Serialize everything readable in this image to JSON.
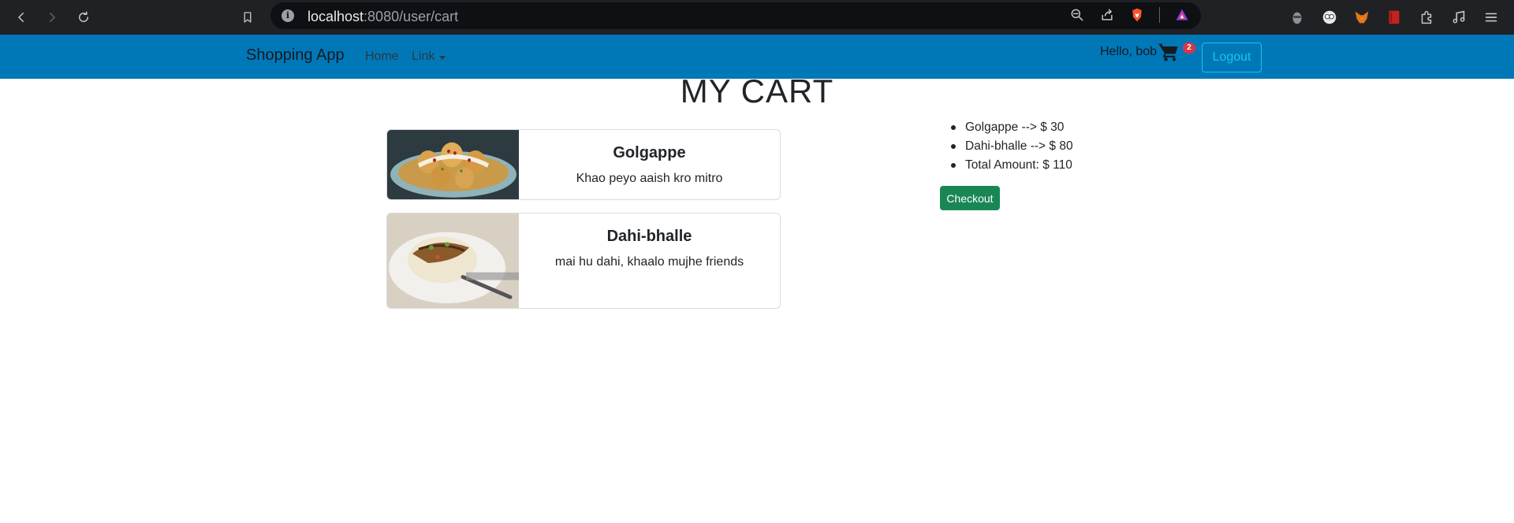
{
  "browser": {
    "url_host": "localhost",
    "url_path": ":8080/user/cart"
  },
  "navbar": {
    "brand": "Shopping App",
    "home_label": "Home",
    "link_label": "Link",
    "greeting": "Hello, bob",
    "cart_count": "2",
    "logout_label": "Logout"
  },
  "page": {
    "title": "MY CART"
  },
  "cart_items": [
    {
      "name": "Golgappe",
      "description": "Khao peyo aaish kro mitro"
    },
    {
      "name": "Dahi-bhalle",
      "description": "mai hu dahi, khaalo mujhe friends"
    }
  ],
  "summary": {
    "lines": [
      "Golgappe --> $ 30",
      "Dahi-bhalle --> $ 80",
      "Total Amount: $ 110"
    ],
    "checkout_label": "Checkout"
  },
  "colors": {
    "navbar_bg": "#0078b8",
    "checkout_bg": "#198754",
    "badge_bg": "#dc3545",
    "logout_outline": "#17c4e8"
  }
}
